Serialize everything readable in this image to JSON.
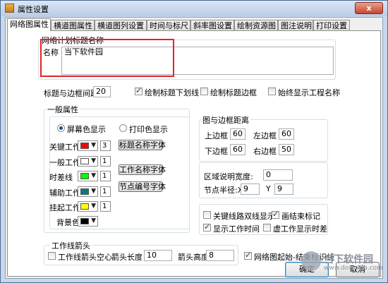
{
  "window": {
    "title": "属性设置",
    "close_glyph": "x"
  },
  "tabs": [
    "网络图属性",
    "横道图属性",
    "横道图列设置",
    "时间与标尺",
    "斜率图设置",
    "绘制资源图",
    "图注说明",
    "打印设置"
  ],
  "plan_title": {
    "group_label": "网络计划标题名称",
    "name_label": "名称",
    "name_value": "当下软件园"
  },
  "title_row": {
    "spacing_label": "标题与边框间距:",
    "spacing_value": "20",
    "draw_underline": "绘制标题下划线",
    "draw_border": "绘制标题边框",
    "show_project_name": "始终显示工程名称"
  },
  "general": {
    "group_label": "一般属性",
    "screen_color": "屏幕色显示",
    "print_color": "打印色显示",
    "rows": [
      {
        "label": "关键工作",
        "color": "#ff0000",
        "spin": "3"
      },
      {
        "label": "一般工作",
        "color": "#ffffff",
        "spin": "1"
      },
      {
        "label": "时差线",
        "color": "#00ff00",
        "spin": "1"
      },
      {
        "label": "辅助工作",
        "color": "#008080",
        "spin": "1"
      },
      {
        "label": "挂起工作",
        "color": "#ffff00",
        "spin": "1"
      },
      {
        "label": "背景色",
        "color": "#000000"
      }
    ],
    "font_buttons": [
      "标题名称字体",
      "工作名称字体",
      "节点编号字体"
    ]
  },
  "frame_distance": {
    "group_label": "图与边框距离",
    "top_label": "上边框",
    "top_value": "60",
    "left_label": "左边框",
    "left_value": "60",
    "bottom_label": "下边框",
    "bottom_value": "60",
    "right_label": "右边框",
    "right_value": "50"
  },
  "region": {
    "width_label": "区域说明宽度:",
    "width_value": "0",
    "radius_label": "节点半径:X",
    "radius_x": "9",
    "y_label": "Y",
    "radius_y": "9"
  },
  "options": {
    "double_line": "关键线路双线显示",
    "draw_end_mark": "画结束标记",
    "show_work_time": "显示工作时间",
    "virtual_slack": "虚工作显示时差"
  },
  "arrow": {
    "group_label": "工作线箭头",
    "hollow_label": "工作线箭头空心",
    "length_label": "箭头长度",
    "length_value": "10",
    "height_label": "箭头高度",
    "height_value": "8"
  },
  "start_end_label": "网络图起始-结束标识线",
  "buttons": {
    "ok": "确定",
    "cancel": "取消"
  },
  "watermark": {
    "text": "当下软件园",
    "url": "www.downxia.com"
  }
}
